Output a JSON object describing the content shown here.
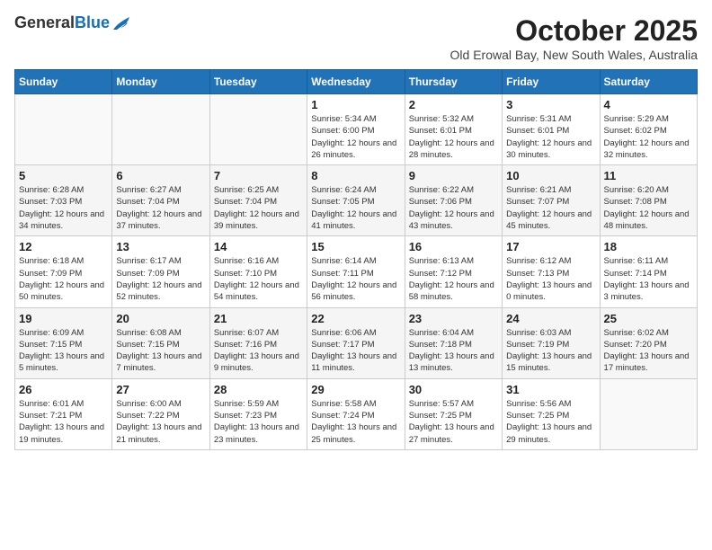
{
  "header": {
    "logo_general": "General",
    "logo_blue": "Blue",
    "month": "October 2025",
    "location": "Old Erowal Bay, New South Wales, Australia"
  },
  "days_of_week": [
    "Sunday",
    "Monday",
    "Tuesday",
    "Wednesday",
    "Thursday",
    "Friday",
    "Saturday"
  ],
  "weeks": [
    [
      {
        "day": null
      },
      {
        "day": null
      },
      {
        "day": null
      },
      {
        "day": "1",
        "sunrise": "Sunrise: 5:34 AM",
        "sunset": "Sunset: 6:00 PM",
        "daylight": "Daylight: 12 hours and 26 minutes."
      },
      {
        "day": "2",
        "sunrise": "Sunrise: 5:32 AM",
        "sunset": "Sunset: 6:01 PM",
        "daylight": "Daylight: 12 hours and 28 minutes."
      },
      {
        "day": "3",
        "sunrise": "Sunrise: 5:31 AM",
        "sunset": "Sunset: 6:01 PM",
        "daylight": "Daylight: 12 hours and 30 minutes."
      },
      {
        "day": "4",
        "sunrise": "Sunrise: 5:29 AM",
        "sunset": "Sunset: 6:02 PM",
        "daylight": "Daylight: 12 hours and 32 minutes."
      }
    ],
    [
      {
        "day": "5",
        "sunrise": "Sunrise: 6:28 AM",
        "sunset": "Sunset: 7:03 PM",
        "daylight": "Daylight: 12 hours and 34 minutes."
      },
      {
        "day": "6",
        "sunrise": "Sunrise: 6:27 AM",
        "sunset": "Sunset: 7:04 PM",
        "daylight": "Daylight: 12 hours and 37 minutes."
      },
      {
        "day": "7",
        "sunrise": "Sunrise: 6:25 AM",
        "sunset": "Sunset: 7:04 PM",
        "daylight": "Daylight: 12 hours and 39 minutes."
      },
      {
        "day": "8",
        "sunrise": "Sunrise: 6:24 AM",
        "sunset": "Sunset: 7:05 PM",
        "daylight": "Daylight: 12 hours and 41 minutes."
      },
      {
        "day": "9",
        "sunrise": "Sunrise: 6:22 AM",
        "sunset": "Sunset: 7:06 PM",
        "daylight": "Daylight: 12 hours and 43 minutes."
      },
      {
        "day": "10",
        "sunrise": "Sunrise: 6:21 AM",
        "sunset": "Sunset: 7:07 PM",
        "daylight": "Daylight: 12 hours and 45 minutes."
      },
      {
        "day": "11",
        "sunrise": "Sunrise: 6:20 AM",
        "sunset": "Sunset: 7:08 PM",
        "daylight": "Daylight: 12 hours and 48 minutes."
      }
    ],
    [
      {
        "day": "12",
        "sunrise": "Sunrise: 6:18 AM",
        "sunset": "Sunset: 7:09 PM",
        "daylight": "Daylight: 12 hours and 50 minutes."
      },
      {
        "day": "13",
        "sunrise": "Sunrise: 6:17 AM",
        "sunset": "Sunset: 7:09 PM",
        "daylight": "Daylight: 12 hours and 52 minutes."
      },
      {
        "day": "14",
        "sunrise": "Sunrise: 6:16 AM",
        "sunset": "Sunset: 7:10 PM",
        "daylight": "Daylight: 12 hours and 54 minutes."
      },
      {
        "day": "15",
        "sunrise": "Sunrise: 6:14 AM",
        "sunset": "Sunset: 7:11 PM",
        "daylight": "Daylight: 12 hours and 56 minutes."
      },
      {
        "day": "16",
        "sunrise": "Sunrise: 6:13 AM",
        "sunset": "Sunset: 7:12 PM",
        "daylight": "Daylight: 12 hours and 58 minutes."
      },
      {
        "day": "17",
        "sunrise": "Sunrise: 6:12 AM",
        "sunset": "Sunset: 7:13 PM",
        "daylight": "Daylight: 13 hours and 0 minutes."
      },
      {
        "day": "18",
        "sunrise": "Sunrise: 6:11 AM",
        "sunset": "Sunset: 7:14 PM",
        "daylight": "Daylight: 13 hours and 3 minutes."
      }
    ],
    [
      {
        "day": "19",
        "sunrise": "Sunrise: 6:09 AM",
        "sunset": "Sunset: 7:15 PM",
        "daylight": "Daylight: 13 hours and 5 minutes."
      },
      {
        "day": "20",
        "sunrise": "Sunrise: 6:08 AM",
        "sunset": "Sunset: 7:15 PM",
        "daylight": "Daylight: 13 hours and 7 minutes."
      },
      {
        "day": "21",
        "sunrise": "Sunrise: 6:07 AM",
        "sunset": "Sunset: 7:16 PM",
        "daylight": "Daylight: 13 hours and 9 minutes."
      },
      {
        "day": "22",
        "sunrise": "Sunrise: 6:06 AM",
        "sunset": "Sunset: 7:17 PM",
        "daylight": "Daylight: 13 hours and 11 minutes."
      },
      {
        "day": "23",
        "sunrise": "Sunrise: 6:04 AM",
        "sunset": "Sunset: 7:18 PM",
        "daylight": "Daylight: 13 hours and 13 minutes."
      },
      {
        "day": "24",
        "sunrise": "Sunrise: 6:03 AM",
        "sunset": "Sunset: 7:19 PM",
        "daylight": "Daylight: 13 hours and 15 minutes."
      },
      {
        "day": "25",
        "sunrise": "Sunrise: 6:02 AM",
        "sunset": "Sunset: 7:20 PM",
        "daylight": "Daylight: 13 hours and 17 minutes."
      }
    ],
    [
      {
        "day": "26",
        "sunrise": "Sunrise: 6:01 AM",
        "sunset": "Sunset: 7:21 PM",
        "daylight": "Daylight: 13 hours and 19 minutes."
      },
      {
        "day": "27",
        "sunrise": "Sunrise: 6:00 AM",
        "sunset": "Sunset: 7:22 PM",
        "daylight": "Daylight: 13 hours and 21 minutes."
      },
      {
        "day": "28",
        "sunrise": "Sunrise: 5:59 AM",
        "sunset": "Sunset: 7:23 PM",
        "daylight": "Daylight: 13 hours and 23 minutes."
      },
      {
        "day": "29",
        "sunrise": "Sunrise: 5:58 AM",
        "sunset": "Sunset: 7:24 PM",
        "daylight": "Daylight: 13 hours and 25 minutes."
      },
      {
        "day": "30",
        "sunrise": "Sunrise: 5:57 AM",
        "sunset": "Sunset: 7:25 PM",
        "daylight": "Daylight: 13 hours and 27 minutes."
      },
      {
        "day": "31",
        "sunrise": "Sunrise: 5:56 AM",
        "sunset": "Sunset: 7:25 PM",
        "daylight": "Daylight: 13 hours and 29 minutes."
      },
      {
        "day": null
      }
    ]
  ]
}
